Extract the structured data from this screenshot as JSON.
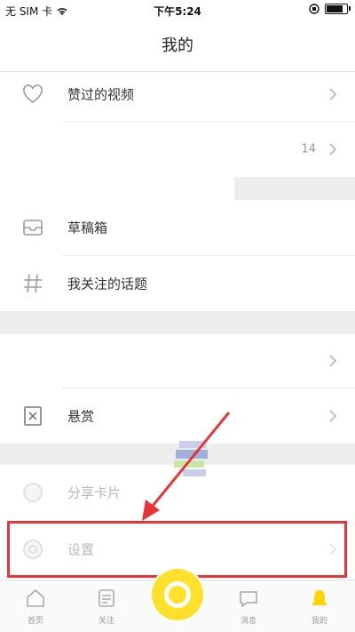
{
  "status_bar": {
    "carrier": "无 SIM 卡",
    "time": "下午5:24",
    "battery_level": 0.9
  },
  "nav": {
    "title": "我的"
  },
  "menu": {
    "liked_videos": "赞过的视频",
    "count_14": "14",
    "drafts": "草稿箱",
    "followed_topics": "我关注的话题",
    "reward": "悬赏",
    "blurred_item": "分享卡片",
    "settings": "设置"
  },
  "tabs": [
    {
      "label": "首页"
    },
    {
      "label": "关注"
    },
    {
      "label": ""
    },
    {
      "label": "消息"
    },
    {
      "label": "我的"
    }
  ],
  "colors": {
    "accent": "#ffe12b",
    "highlight": "#e8353a"
  }
}
